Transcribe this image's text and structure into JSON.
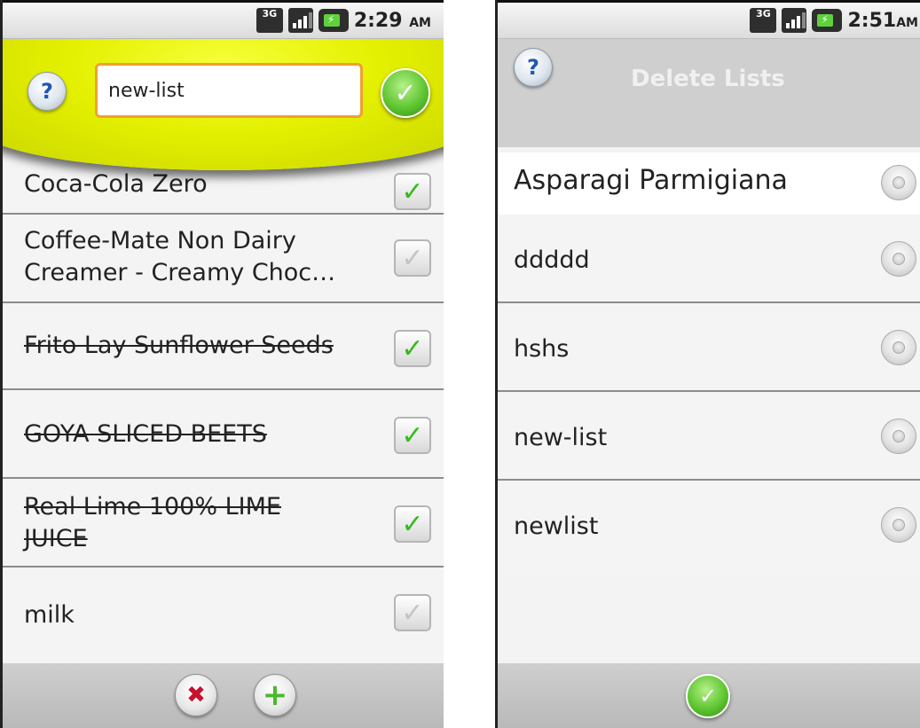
{
  "left_screen": {
    "status_time": "2:29",
    "status_ampm": "AM",
    "status_3g": "3G",
    "list_name_value": "new-list",
    "partial_item": "Coca-Cola Zero",
    "items": [
      {
        "text": "Coffee-Mate Non Dairy Creamer  - Creamy Choc…",
        "checked": false,
        "struck": false
      },
      {
        "text": "Frito Lay Sunflower Seeds",
        "checked": true,
        "struck": true
      },
      {
        "text": "GOYA SLICED BEETS",
        "checked": true,
        "struck": true
      },
      {
        "text": "Real Lime 100% LIME JUICE",
        "checked": true,
        "struck": true
      },
      {
        "text": "milk",
        "checked": false,
        "struck": false
      }
    ],
    "icons": {
      "help": "?",
      "confirm": "✓",
      "cancel": "✖",
      "add": "+",
      "check": "✓"
    }
  },
  "right_screen": {
    "status_time": "2:51",
    "status_ampm": "AM",
    "status_3g": "3G",
    "title": "Delete Lists",
    "lists": [
      {
        "text": "Asparagi Parmigiana"
      },
      {
        "text": "ddddd"
      },
      {
        "text": "hshs"
      },
      {
        "text": "new-list"
      },
      {
        "text": "newlist"
      }
    ],
    "icons": {
      "help": "?",
      "confirm": "✓"
    }
  },
  "colors": {
    "header_yellow": "#e4f000",
    "checkbox_green": "#38b81e",
    "cancel_red": "#c8102e",
    "input_border": "#f0a030"
  }
}
